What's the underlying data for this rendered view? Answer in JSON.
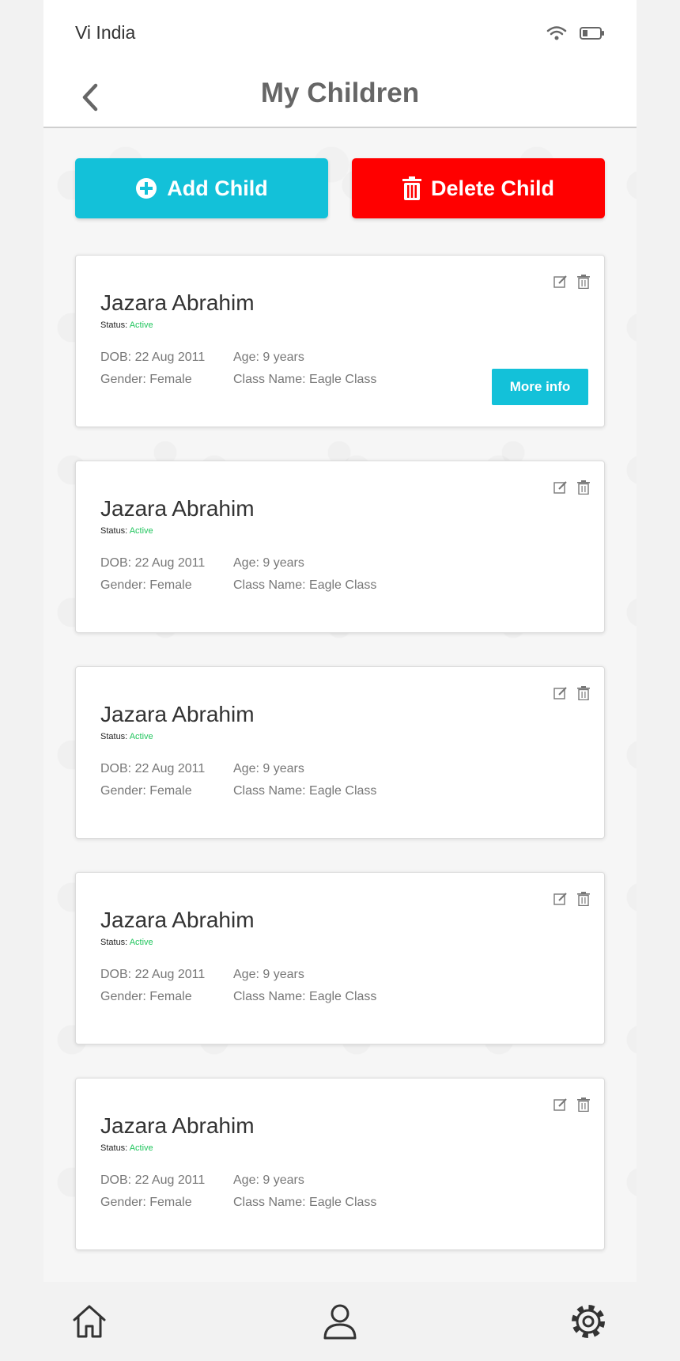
{
  "status_bar": {
    "carrier": "Vi India"
  },
  "header": {
    "title": "My Children"
  },
  "actions": {
    "add_label": "Add Child",
    "delete_label": "Delete Child"
  },
  "colors": {
    "accent": "#13c1d9",
    "danger": "#ff0000",
    "active": "#22c55e"
  },
  "children": [
    {
      "name": "Jazara Abrahim",
      "status_label": "Status:",
      "status": "Active",
      "dob": "DOB: 22 Aug 2011",
      "age": "Age: 9 years",
      "gender": "Gender: Female",
      "class_name": "Class Name: Eagle Class",
      "more_info": "More info"
    },
    {
      "name": "Jazara Abrahim",
      "status_label": "Status:",
      "status": "Active",
      "dob": "DOB: 22 Aug 2011",
      "age": "Age: 9 years",
      "gender": "Gender: Female",
      "class_name": "Class Name: Eagle Class"
    },
    {
      "name": "Jazara Abrahim",
      "status_label": "Status:",
      "status": "Active",
      "dob": "DOB: 22 Aug 2011",
      "age": "Age: 9 years",
      "gender": "Gender: Female",
      "class_name": "Class Name: Eagle Class"
    },
    {
      "name": "Jazara Abrahim",
      "status_label": "Status:",
      "status": "Active",
      "dob": "DOB: 22 Aug 2011",
      "age": "Age: 9 years",
      "gender": "Gender: Female",
      "class_name": "Class Name: Eagle Class"
    },
    {
      "name": "Jazara Abrahim",
      "status_label": "Status:",
      "status": "Active",
      "dob": "DOB: 22 Aug 2011",
      "age": "Age: 9 years",
      "gender": "Gender: Female",
      "class_name": "Class Name: Eagle Class"
    }
  ],
  "bottom_nav": {
    "items": [
      "home-icon",
      "profile-icon",
      "settings-icon"
    ]
  }
}
